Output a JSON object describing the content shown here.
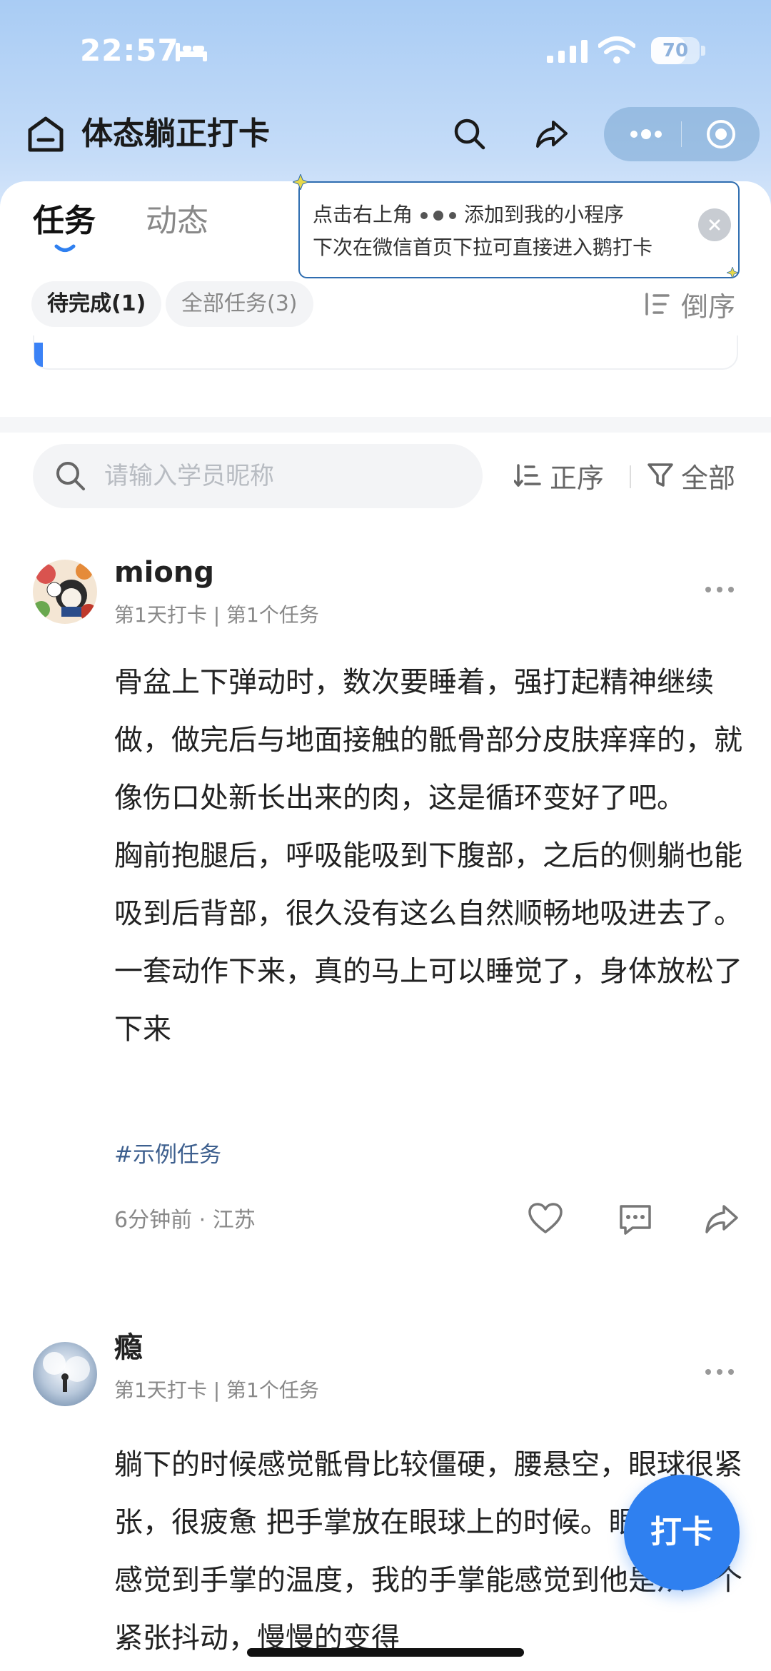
{
  "status_bar": {
    "time": "22:57",
    "battery": "70",
    "battery_level": 0.7
  },
  "header": {
    "title": "体态躺正打卡"
  },
  "tabs": [
    {
      "label": "任务",
      "active": true
    },
    {
      "label": "动态",
      "active": false
    }
  ],
  "tooltip": {
    "line1_prefix": "点击右上角",
    "line1_suffix": "添加到我的小程序",
    "line2": "下次在微信首页下拉可直接进入鹅打卡"
  },
  "filters": {
    "pending": "待完成(1)",
    "all_tasks": "全部任务(3)",
    "order": "倒序"
  },
  "search": {
    "placeholder": "请输入学员昵称",
    "sort_label": "正序",
    "filter_label": "全部"
  },
  "posts": [
    {
      "username": "miong",
      "meta": "第1天打卡 | 第1个任务",
      "paragraphs": [
        "骨盆上下弹动时，数次要睡着，强打起精神继续做，做完后与地面接触的骶骨部分皮肤痒痒的，就像伤口处新长出来的肉，这是循环变好了吧。",
        "胸前抱腿后，呼吸能吸到下腹部，之后的侧躺也能吸到后背部，很久没有这么自然顺畅地吸进去了。一套动作下来，真的马上可以睡觉了，身体放松了下来"
      ],
      "hashtag": "#示例任务",
      "time_location": "6分钟前 · 江苏"
    },
    {
      "username": "瘾",
      "meta": "第1天打卡 | 第1个任务",
      "paragraphs": [
        "躺下的时候感觉骶骨比较僵硬，腰悬空，眼球很紧张，很疲惫 把手掌放在眼球上的时候。眼球就能感觉到手掌的温度，我的手掌能感觉到他是从一个紧张抖动，慢慢的变得"
      ]
    }
  ],
  "fab": {
    "label": "打卡"
  },
  "colors": {
    "accent": "#2f80f0",
    "hashtag": "#3d5f8e",
    "tooltip_border": "#2f6db0"
  }
}
